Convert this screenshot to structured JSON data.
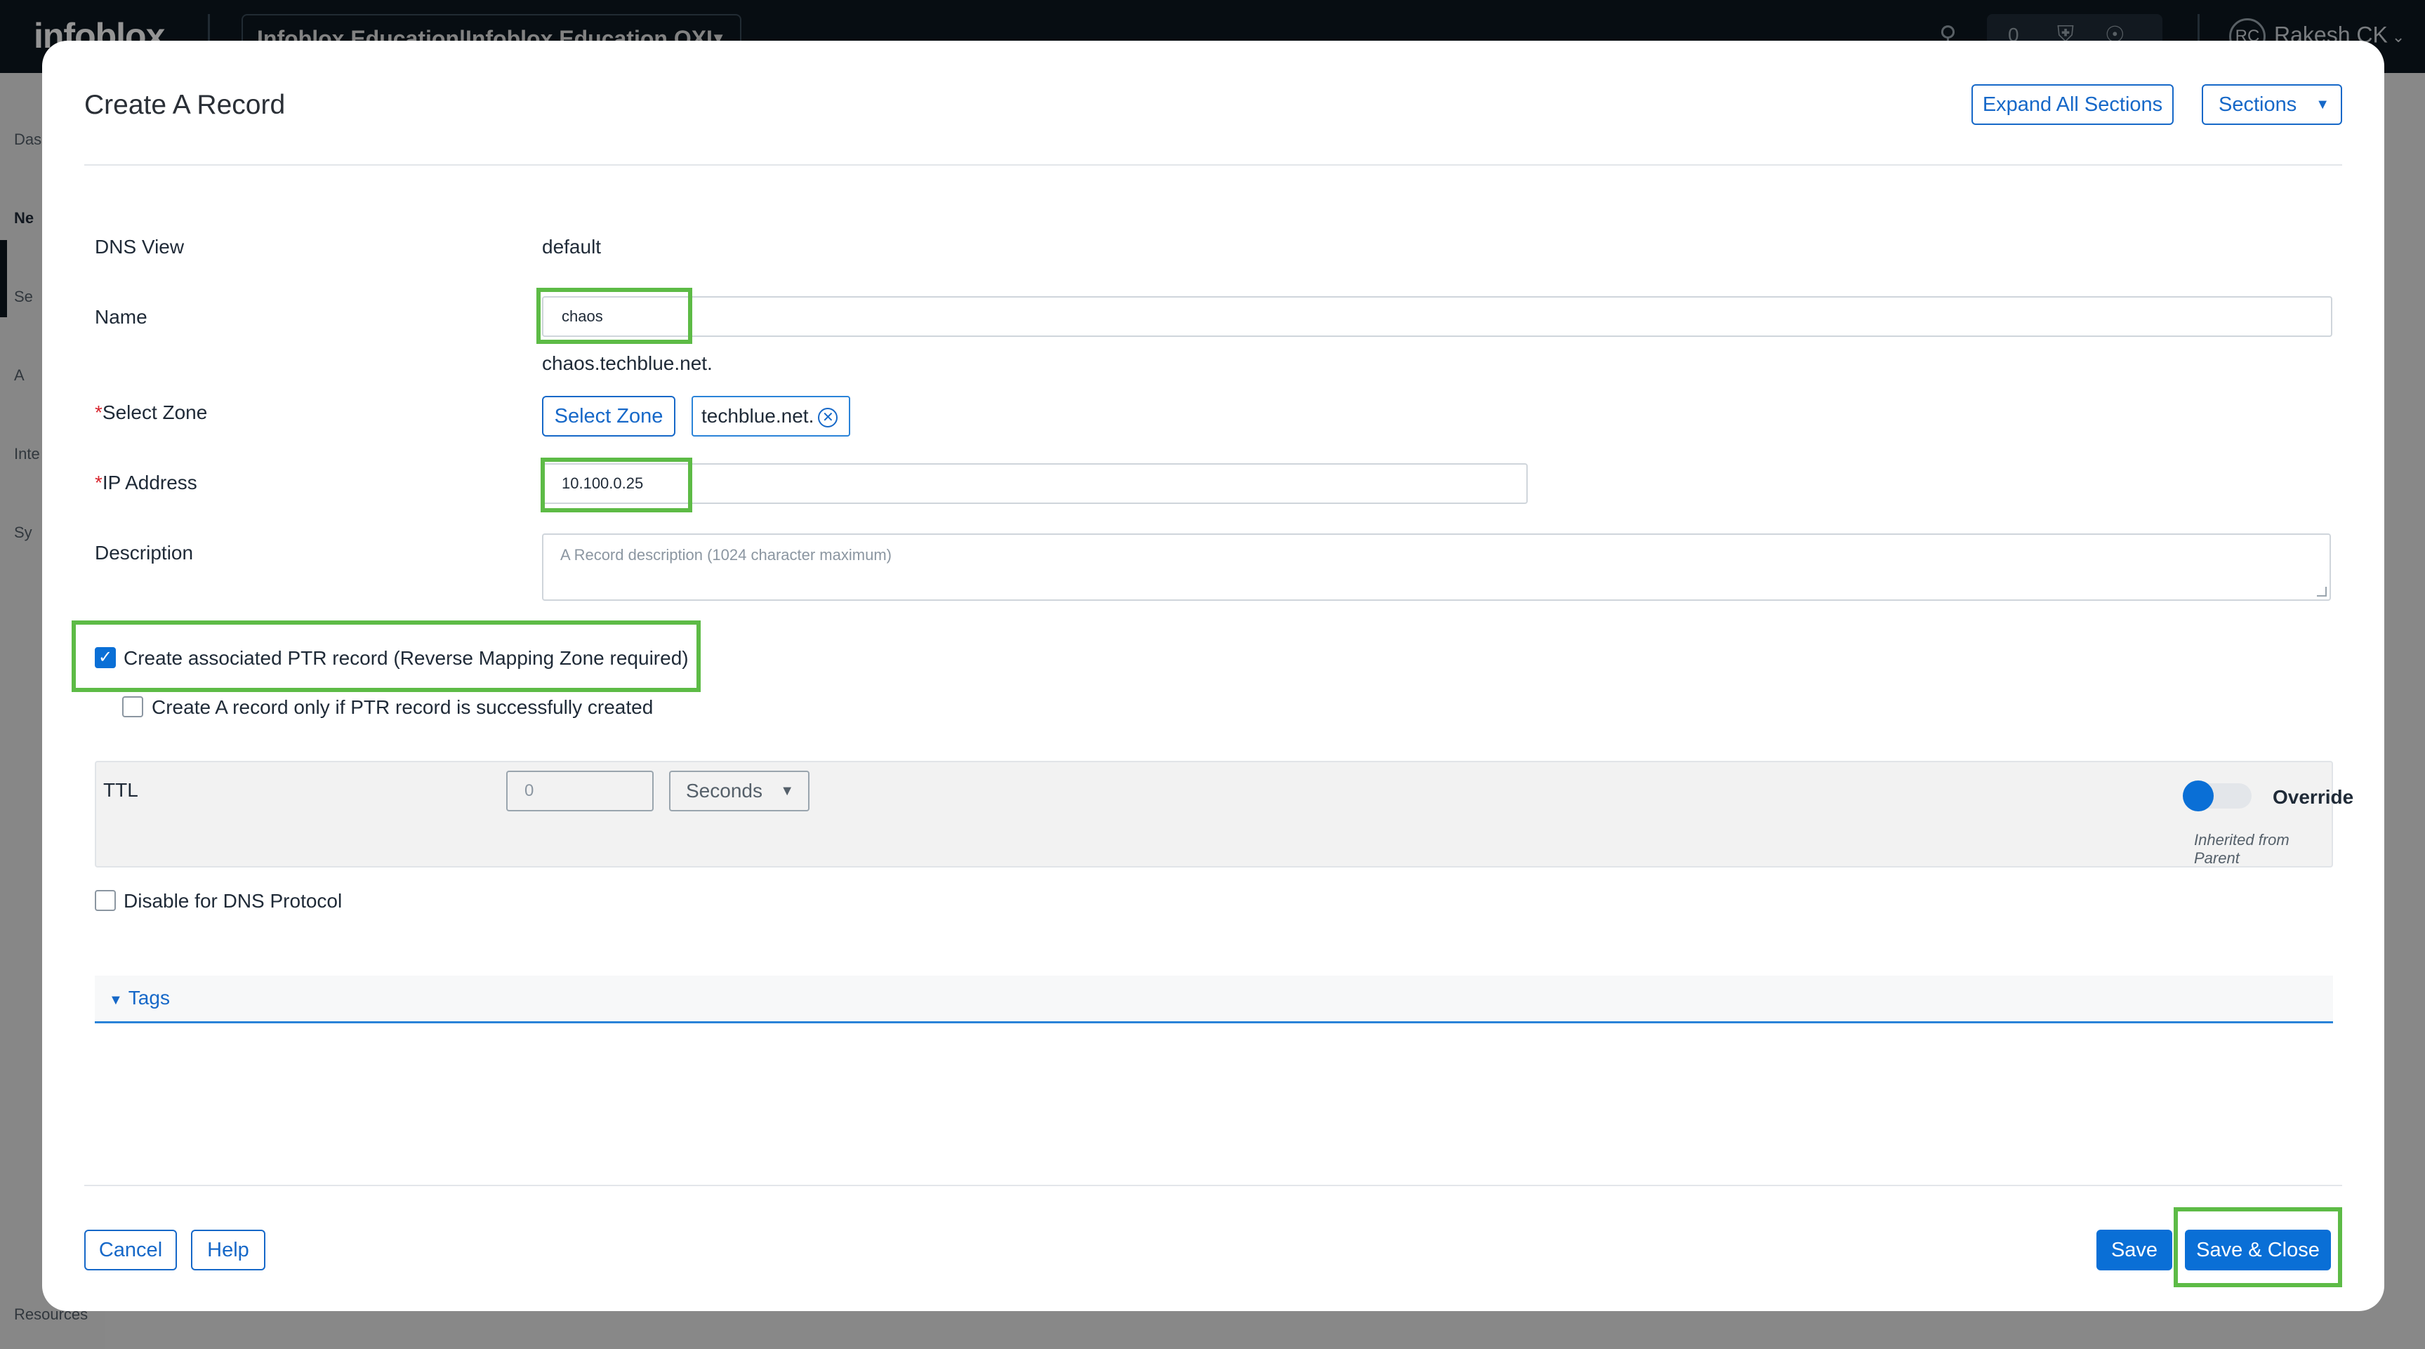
{
  "app": {
    "logo": "infoblox",
    "tenant": "Infoblox Education|Infoblox Education OXI",
    "counter": "0",
    "user_initials": "RC",
    "user_name": "Rakesh CK",
    "nav": [
      "Das",
      "Ne",
      "Se",
      "A",
      "Inte",
      "Sy",
      "Resources"
    ]
  },
  "modal": {
    "title": "Create A Record",
    "expand_all_label": "Expand All Sections",
    "sections_label": "Sections"
  },
  "form": {
    "dns_view_label": "DNS View",
    "dns_view_value": "default",
    "name_label": "Name",
    "name_value": "chaos",
    "fqdn_preview": "chaos.techblue.net.",
    "zone_required": "*",
    "zone_label": "Select Zone",
    "select_zone_button": "Select Zone",
    "zone_chip": "techblue.net.",
    "ip_required": "*",
    "ip_label": "IP Address",
    "ip_value": "10.100.0.25",
    "description_label": "Description",
    "description_placeholder": "A Record description (1024 character maximum)",
    "ptr_checkbox_label": "Create associated PTR record (Reverse Mapping Zone required)",
    "ptr_checked": true,
    "a_only_label": "Create A record only if PTR record is successfully created",
    "ttl_label": "TTL",
    "ttl_value": "0",
    "ttl_unit": "Seconds",
    "override_label": "Override",
    "inherited_label": "Inherited from Parent",
    "disable_dns_label": "Disable for DNS Protocol",
    "tags_label": "Tags"
  },
  "footer": {
    "cancel_label": "Cancel",
    "help_label": "Help",
    "save_label": "Save",
    "save_close_label": "Save & Close"
  },
  "colors": {
    "highlight": "#5dbb46",
    "primary": "#0a6fd6",
    "required": "#d8262f"
  }
}
